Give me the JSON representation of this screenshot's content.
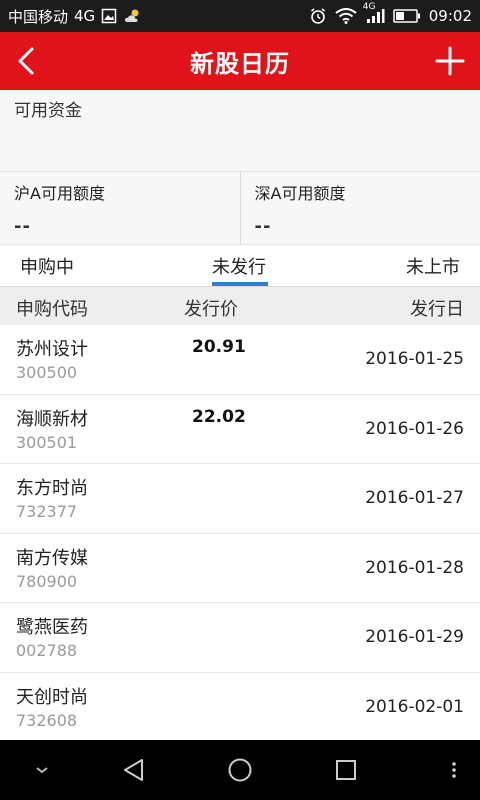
{
  "status_bar": {
    "carrier": "中国移动",
    "network": "4G",
    "signal_label": "4G",
    "time": "09:02"
  },
  "app_bar": {
    "title": "新股日历"
  },
  "funds": {
    "label": "可用资金"
  },
  "quota": {
    "sh_label": "沪A可用额度",
    "sh_value": "--",
    "sz_label": "深A可用额度",
    "sz_value": "--"
  },
  "tabs": [
    {
      "label": "申购中"
    },
    {
      "label": "未发行"
    },
    {
      "label": "未上市"
    }
  ],
  "columns": {
    "code": "申购代码",
    "price": "发行价",
    "date": "发行日"
  },
  "rows": [
    {
      "name": "苏州设计",
      "code": "300500",
      "price": "20.91",
      "date": "2016-01-25"
    },
    {
      "name": "海顺新材",
      "code": "300501",
      "price": "22.02",
      "date": "2016-01-26"
    },
    {
      "name": "东方时尚",
      "code": "732377",
      "price": "",
      "date": "2016-01-27"
    },
    {
      "name": "南方传媒",
      "code": "780900",
      "price": "",
      "date": "2016-01-28"
    },
    {
      "name": "鹭燕医药",
      "code": "002788",
      "price": "",
      "date": "2016-01-29"
    },
    {
      "name": "天创时尚",
      "code": "732608",
      "price": "",
      "date": "2016-02-01"
    }
  ],
  "colors": {
    "brand_red": "#e0131b",
    "tab_indicator": "#2f7fd4"
  }
}
